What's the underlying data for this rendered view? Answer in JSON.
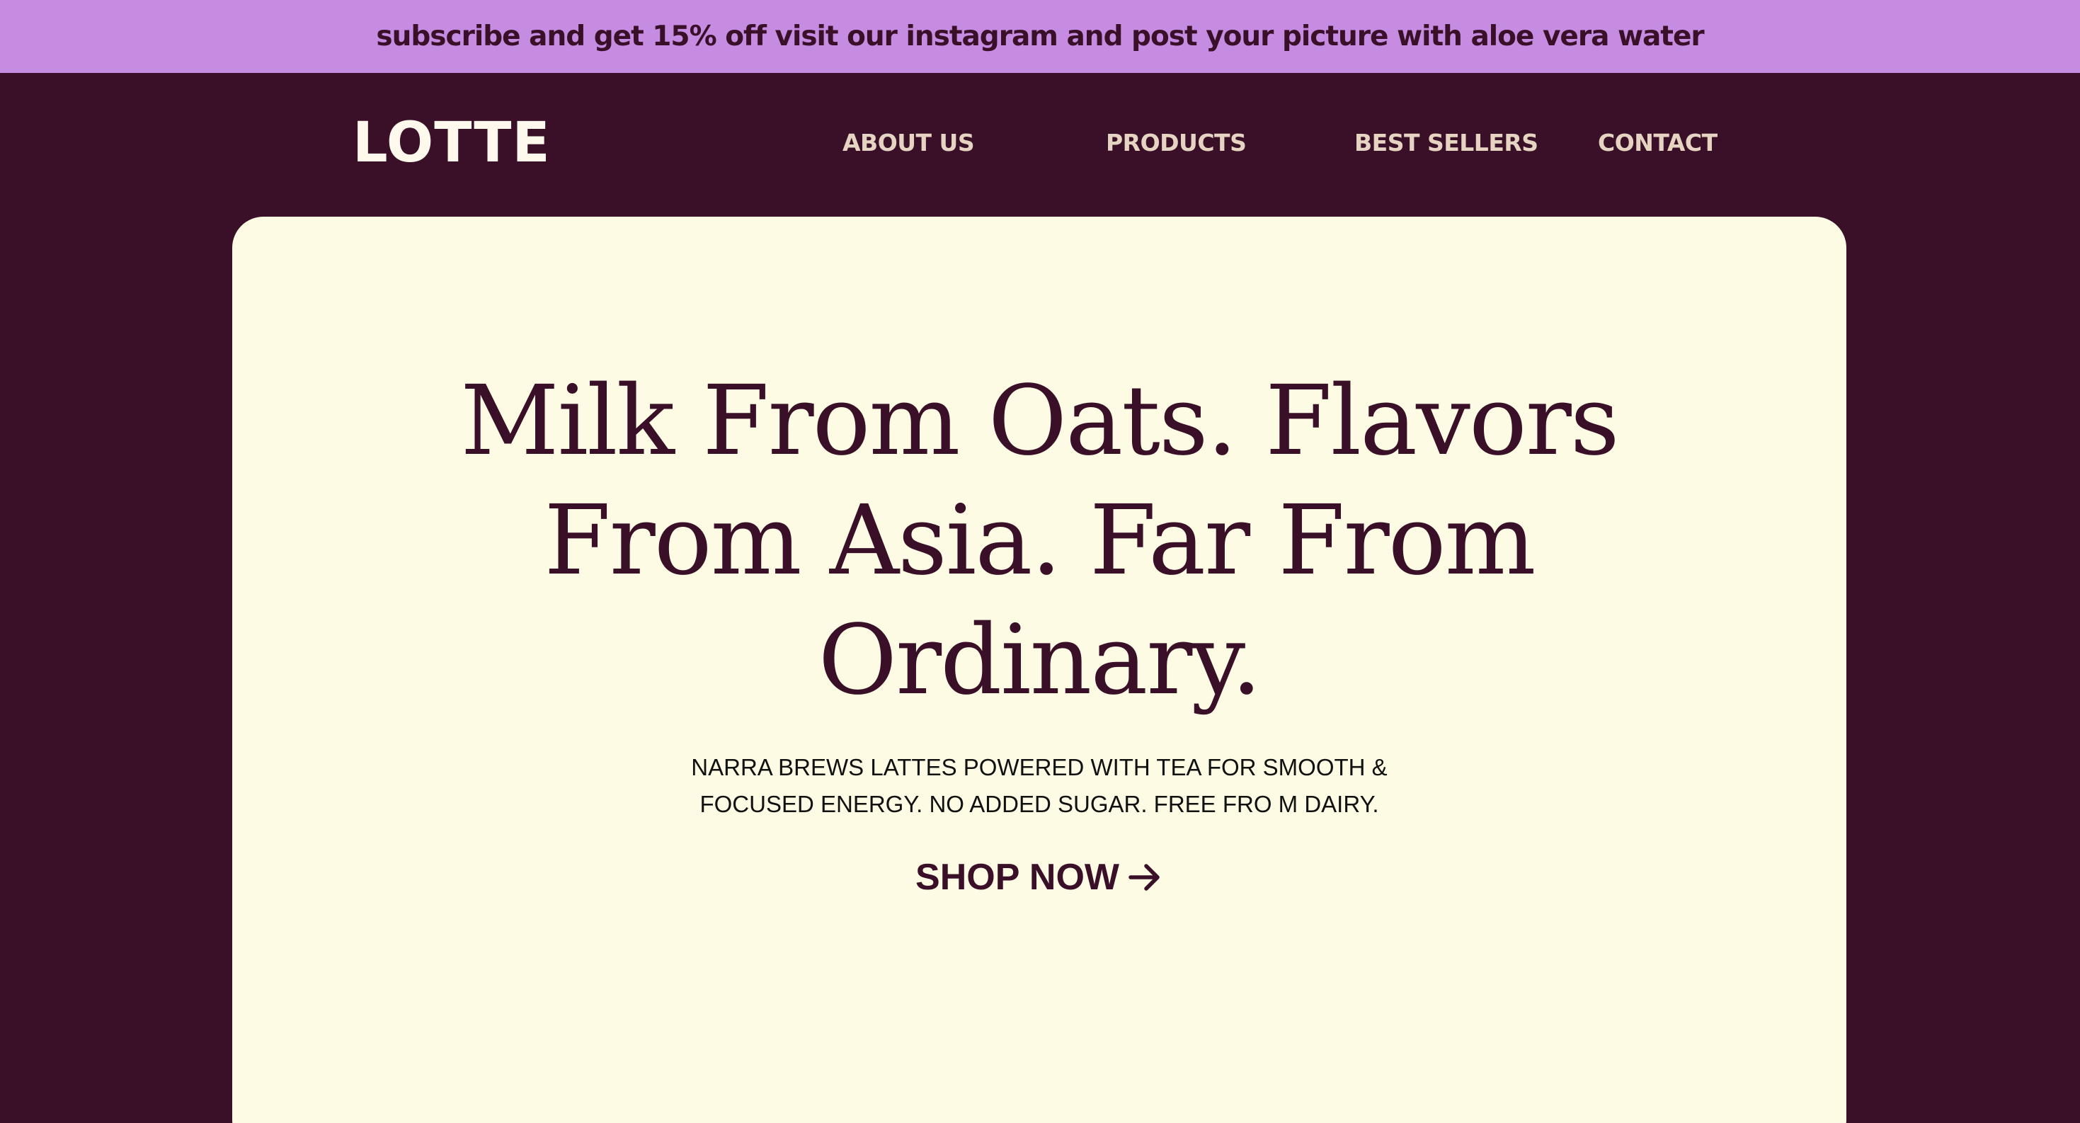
{
  "promo_banner": {
    "text": "subscribe and get 15% off visit our instagram and post your picture with aloe vera water"
  },
  "header": {
    "logo": "LOTTE",
    "nav": [
      {
        "label": "ABOUT US"
      },
      {
        "label": "PRODUCTS"
      },
      {
        "label": "BEST SELLERS"
      },
      {
        "label": "CONTACT"
      }
    ]
  },
  "hero": {
    "heading": "Milk From Oats. Flavors From Asia. Far From Ordinary.",
    "subtext": "NARRA BREWS LATTES POWERED WITH TEA FOR SMOOTH & FOCUSED ENERGY. NO ADDED SUGAR. FREE FRO M DAIRY.",
    "cta_label": "SHOP NOW",
    "cta_icon": "arrow-right-icon"
  },
  "colors": {
    "background": "#3a0f28",
    "banner": "#c58ce2",
    "card": "#fdfbe3",
    "logo": "#fff8ec",
    "nav": "#e6d4c2",
    "text_dark": "#3a0f28"
  }
}
